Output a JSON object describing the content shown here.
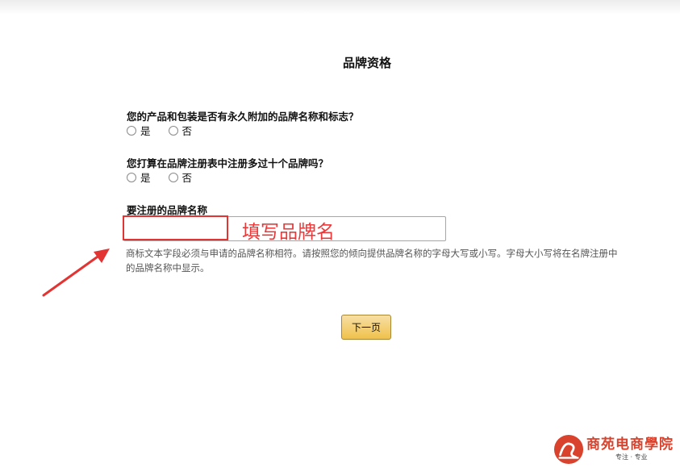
{
  "page": {
    "title": "品牌资格"
  },
  "questions": [
    {
      "text": "您的产品和包装是否有永久附加的品牌名称和标志？",
      "options": [
        "是",
        "否"
      ]
    },
    {
      "text": "您打算在品牌注册表中注册多过十个品牌吗？",
      "options": [
        "是",
        "否"
      ]
    }
  ],
  "brand_field": {
    "label": "要注册的品牌名称",
    "value": "",
    "helper": "商标文本字段必须与申请的品牌名称相符。请按照您的倾向提供品牌名称的字母大写或小写。字母大小写将在名牌注册中的品牌名称中显示。"
  },
  "annotation": {
    "text": "填写品牌名",
    "color": "#e83a3a"
  },
  "actions": {
    "next_label": "下一页"
  },
  "watermark": {
    "name": "商苑电商學院",
    "slogan": "专注 · 专业"
  },
  "colors": {
    "button_bg": "#f0c14b",
    "button_border": "#a88734",
    "annotation_red": "#e33434"
  }
}
